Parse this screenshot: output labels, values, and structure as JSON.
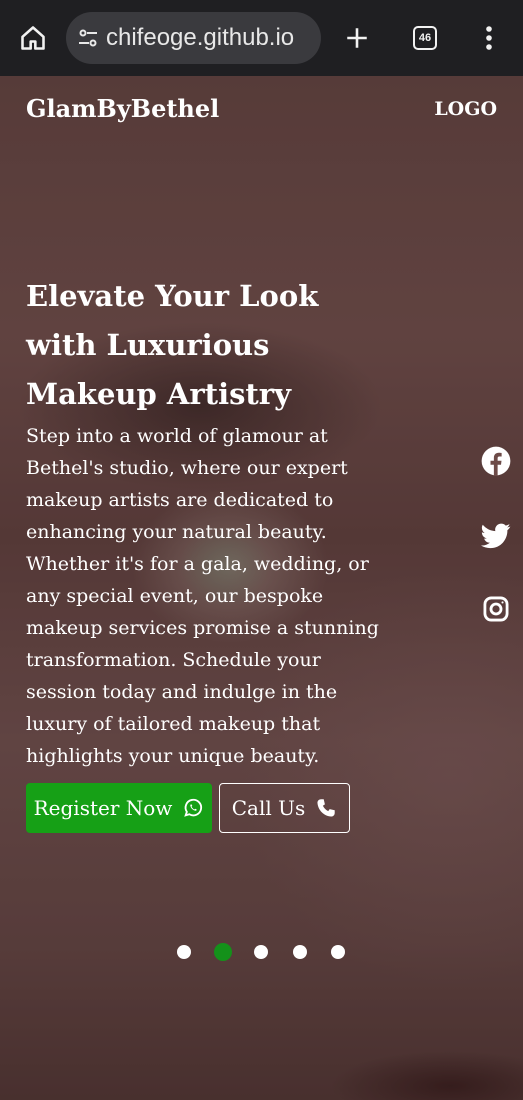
{
  "browser": {
    "url": "chifeoge.github.io",
    "tab_count": "46",
    "icons": [
      "home-icon",
      "site-settings-icon",
      "new-tab-icon",
      "tab-switcher-icon",
      "more-menu-icon"
    ]
  },
  "site": {
    "brand": "GlamByBethel",
    "logo": "LOGO"
  },
  "hero": {
    "headline": "Elevate Your Look with Luxurious Makeup Artistry",
    "description": "Step into a world of glamour at Bethel's studio, where our expert makeup artists are dedicated to enhancing your natural beauty. Whether it's for a gala, wedding, or any special event, our bespoke makeup services promise a stunning transformation. Schedule your session today and indulge in the luxury of tailored makeup that highlights your unique beauty.",
    "register_label": "Register Now",
    "call_label": "Call Us"
  },
  "social": [
    "facebook-icon",
    "twitter-icon",
    "instagram-icon"
  ],
  "carousel": {
    "slides": 5,
    "active_index": 1
  },
  "colors": {
    "accent_green": "#16a016",
    "browser_bg": "#1f1f22"
  }
}
